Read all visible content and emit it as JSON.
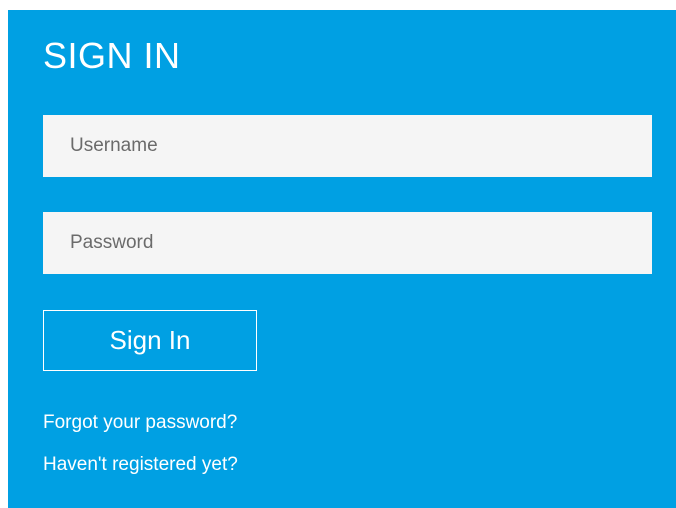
{
  "login": {
    "title": "SIGN IN",
    "username_placeholder": "Username",
    "username_value": "",
    "password_placeholder": "Password",
    "password_value": "",
    "submit_label": "Sign In",
    "forgot_link": "Forgot your password?",
    "register_link": "Haven't registered yet?"
  },
  "colors": {
    "panel_background": "#00a0e3",
    "input_background": "#f5f5f5",
    "text": "#ffffff"
  }
}
